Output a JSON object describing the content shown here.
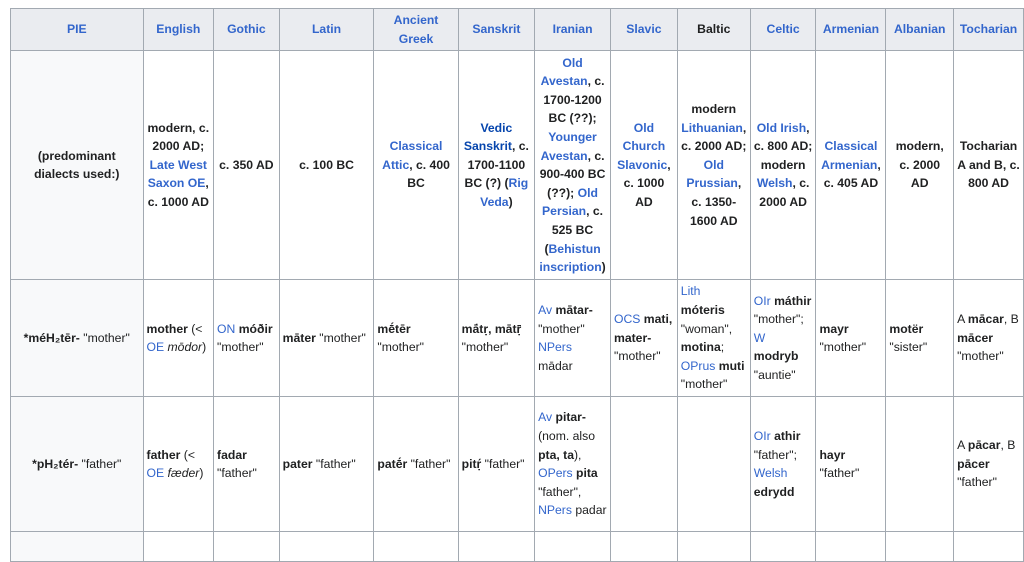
{
  "headers": [
    "PIE",
    "English",
    "Gothic",
    "Latin",
    "Ancient Greek",
    "Sanskrit",
    "Iranian",
    "Slavic",
    "Baltic",
    "Celtic",
    "Armenian",
    "Albanian",
    "Tocharian"
  ],
  "dialects": {
    "label": "(predominant dialects used:)",
    "english": [
      "modern, c. 2000 AD; ",
      "Late West Saxon OE",
      ", c. 1000 AD"
    ],
    "gothic": "c. 350 AD",
    "latin": "c. 100 BC",
    "greek": [
      "Classical Attic",
      ", c. 400 BC"
    ],
    "sanskrit": [
      "Vedic Sanskrit",
      ", c. 1700-1100 BC (?) (",
      "Rig Veda",
      ")"
    ],
    "iranian": [
      "Old Avestan",
      ", c. 1700-1200 BC (??); ",
      "Younger Avestan",
      ", c. 900-400 BC (??); ",
      "Old Persian",
      ", c. 525 BC (",
      "Behistun inscription",
      ")"
    ],
    "slavic": [
      "Old Church Slavonic",
      ", c. 1000 AD"
    ],
    "baltic": [
      "modern ",
      "Lithuanian",
      ", c. 2000 AD; ",
      "Old Prussian",
      ", c. 1350-1600 AD"
    ],
    "celtic": [
      "Old Irish",
      ", c. 800 AD; modern ",
      "Welsh",
      ", c. 2000 AD"
    ],
    "armenian": [
      "Classical Armenian",
      ", c. 405 AD"
    ],
    "albanian": "modern, c. 2000 AD",
    "tocharian": "Tocharian A and B, c. 800 AD"
  },
  "mother": {
    "pie": [
      "*méH₂tēr-",
      " \"mother\""
    ],
    "english": [
      "mother",
      " (< ",
      "OE",
      " mōdor",
      ")"
    ],
    "gothic": [
      "ON",
      " móðir",
      " \"mother\""
    ],
    "latin": [
      "māter",
      " \"mother\""
    ],
    "greek": [
      "mḗtēr",
      " \"mother\""
    ],
    "sanskrit": [
      "mā́tṛ, mātṝ",
      " \"mother\""
    ],
    "iranian": [
      "Av",
      " mātar-",
      " \"mother\" ",
      "NPers",
      " mādar"
    ],
    "slavic": [
      "OCS",
      " mati, mater-",
      " \"mother\""
    ],
    "baltic": [
      "Lith",
      " móteris",
      " \"woman\", ",
      "motina",
      "; ",
      "OPrus",
      " muti",
      " \"mother\""
    ],
    "celtic": [
      "OIr",
      " máthir",
      " \"mother\"; ",
      "W",
      " modryb",
      " \"auntie\""
    ],
    "armenian": [
      "mayr",
      " \"mother\""
    ],
    "albanian": [
      "motër",
      " \"sister\""
    ],
    "tocharian": [
      "A ",
      "mācar",
      ", B ",
      "mācer",
      " \"mother\""
    ]
  },
  "father": {
    "pie": [
      "*pH₂tér-",
      " \"father\""
    ],
    "english": [
      "father",
      " (< ",
      "OE",
      " fæder",
      ")"
    ],
    "gothic": [
      "fadar",
      " \"father\""
    ],
    "latin": [
      "pater",
      " \"father\""
    ],
    "greek": [
      "patḗr",
      " \"father\""
    ],
    "sanskrit": [
      "pitṛ́",
      " \"father\""
    ],
    "iranian": [
      "Av",
      " pitar-",
      " (nom. also ",
      "pta, ta",
      "), ",
      "OPers",
      " pita",
      " \"father\", ",
      "NPers",
      " padar"
    ],
    "celtic": [
      "OIr",
      " athir",
      " \"father\"; ",
      "Welsh",
      " edrydd"
    ],
    "armenian": [
      "hayr",
      " \"father\""
    ],
    "tocharian": [
      "A ",
      "pācar",
      ", B ",
      "pācer",
      " \"father\""
    ]
  },
  "colors": {
    "link": "#3366cc",
    "header_bg": "#eaecf0",
    "border": "#a2a9b1",
    "row_bg": "#f8f9fa"
  }
}
